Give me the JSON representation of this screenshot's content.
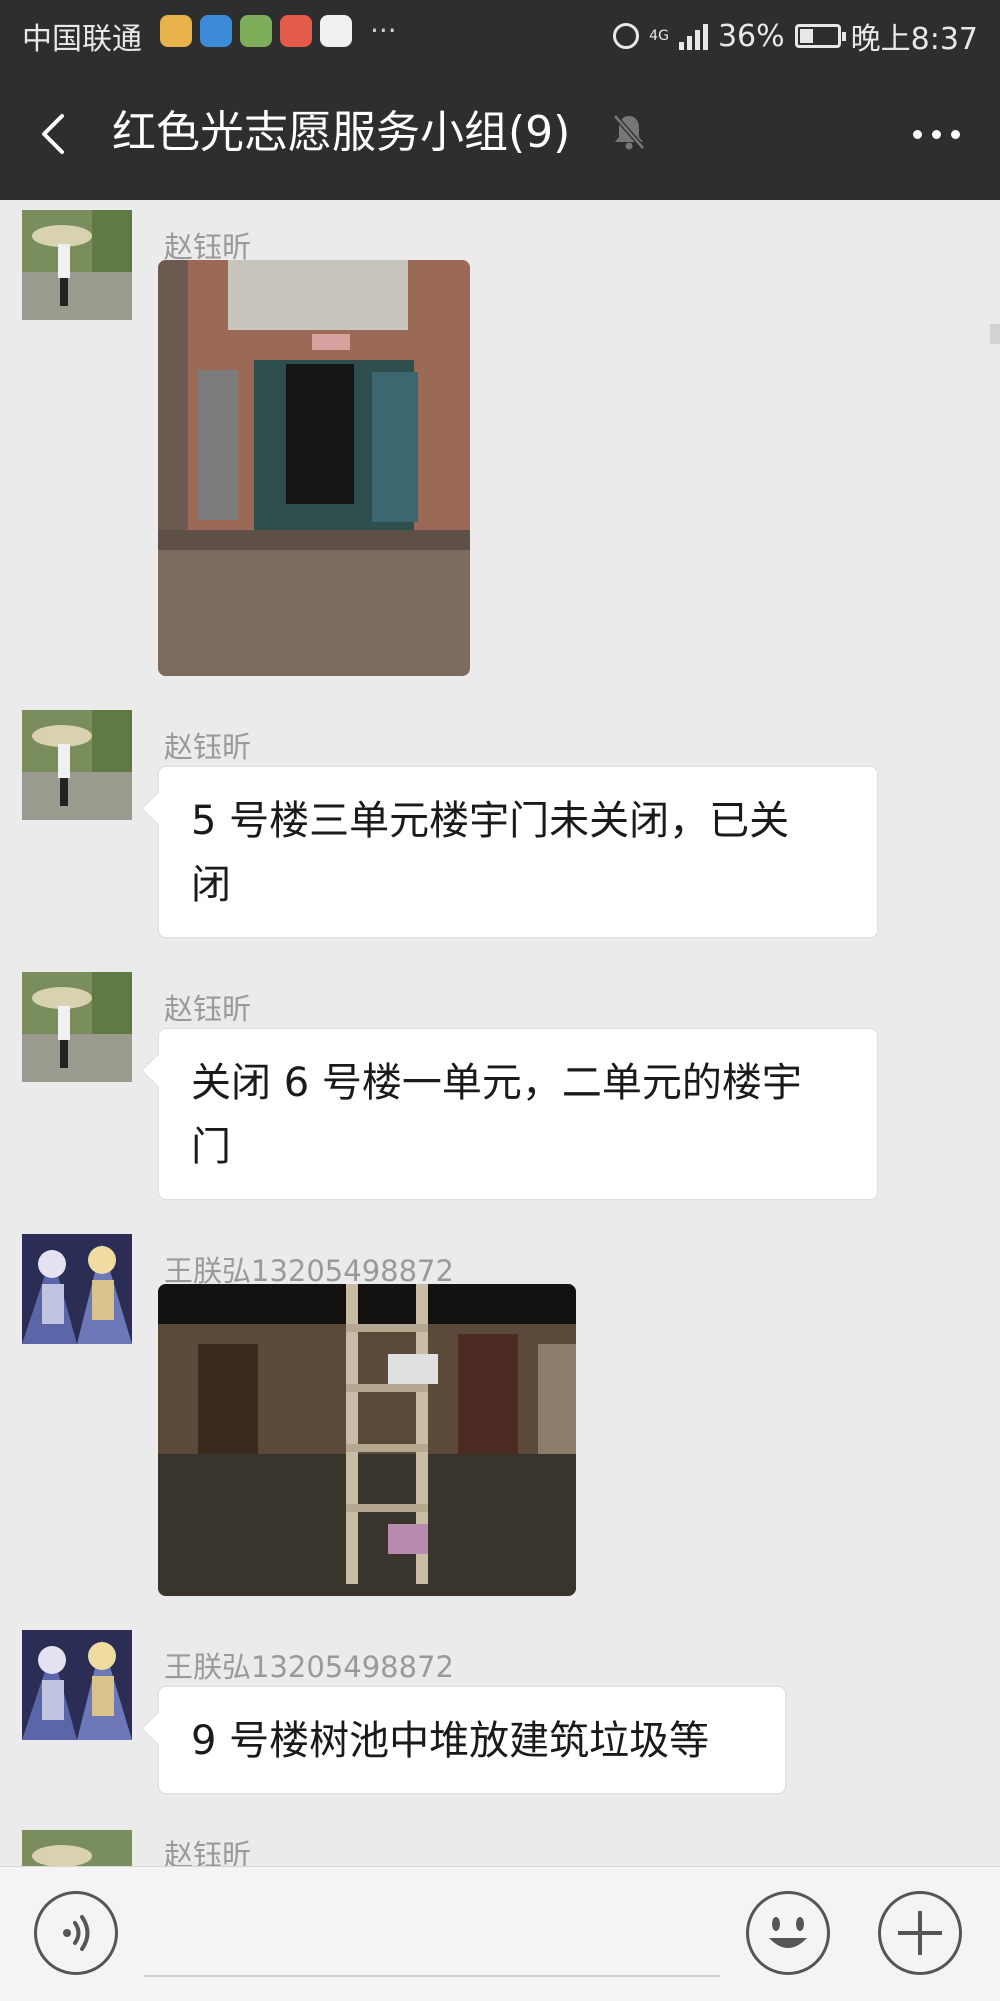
{
  "status_bar": {
    "carrier": "中国联通",
    "more_notifications": "···",
    "network_top": "4G",
    "network_bottom": "",
    "battery_percent": "36%",
    "battery_level": 0.36,
    "time": "晚上8:37"
  },
  "header": {
    "title": "红色光志愿服务小组(9)",
    "muted": true
  },
  "messages": [
    {
      "sender": "赵钰昕",
      "type": "image",
      "image_desc": "building-doorway-photo"
    },
    {
      "sender": "赵钰昕",
      "type": "text",
      "lines": [
        "5 号楼三单元楼宇门未关闭，已关",
        "闭"
      ]
    },
    {
      "sender": "赵钰昕",
      "type": "text",
      "lines": [
        "关闭 6 号楼一单元，二单元的楼宇",
        "门"
      ]
    },
    {
      "sender": "王朕弘13205498872",
      "type": "image",
      "image_desc": "ladder-at-night-photo"
    },
    {
      "sender": "王朕弘13205498872",
      "type": "text",
      "lines": [
        "9 号楼树池中堆放建筑垃圾等"
      ]
    },
    {
      "sender": "赵钰昕",
      "type": "partial"
    }
  ],
  "input_bar": {
    "icons": [
      "voice-icon",
      "emoji-icon",
      "plus-icon"
    ]
  },
  "colors": {
    "header_bg": "#2e2e2e",
    "chat_bg": "#ebebeb",
    "bubble_bg": "#ffffff"
  }
}
